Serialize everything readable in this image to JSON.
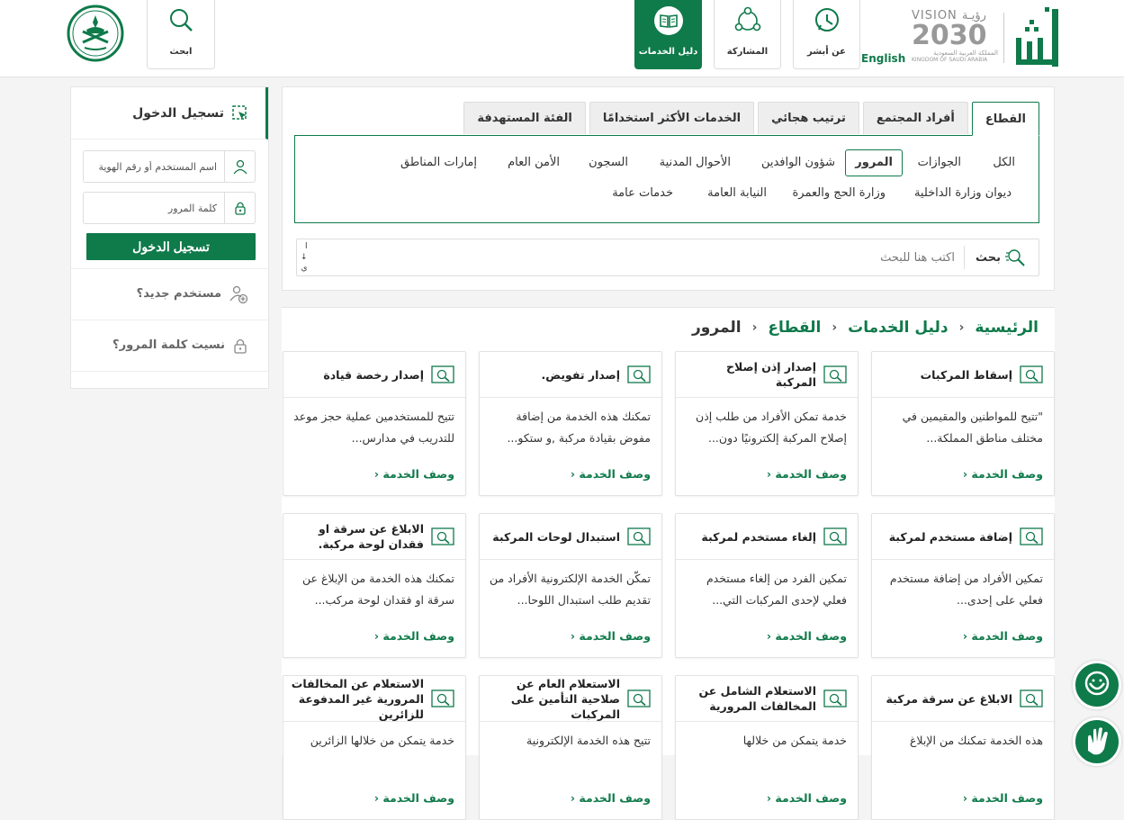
{
  "header": {
    "logo_text": "أبشر",
    "vision": {
      "line1": "VISION",
      "line1_ar": "رؤيـة",
      "year": "2030",
      "ar_country": "المملكة العربية السعودية",
      "en_country": "KINGDOM OF SAUDI ARABIA"
    },
    "nav": [
      {
        "label": "عن أبشر",
        "icon": "chat-bubble-icon"
      },
      {
        "label": "المشاركة",
        "icon": "community-icon"
      },
      {
        "label": "دليل الخدمات",
        "icon": "book-icon",
        "active": true
      }
    ],
    "lang": "English",
    "search_label": "ابحث"
  },
  "login": {
    "title": "تسجيل الدخول",
    "username_placeholder": "اسم المستخدم أو رقم الهوية",
    "password_placeholder": "كلمة المرور",
    "submit": "تسجيل الدخول",
    "new_user": "مستخدم جديد؟",
    "forgot": "نسيت كلمة المرور؟"
  },
  "filter": {
    "tabs": [
      "القطاع",
      "أفراد المجتمع",
      "ترتيب هجائي",
      "الخدمات الأكثر استخدامًا",
      "الفئة المستهدفة"
    ],
    "chips_row1": [
      "الكل",
      "الجوازات",
      "المرور",
      "شؤون الوافدين",
      "الأحوال المدنية",
      "السجون",
      "الأمن العام",
      "إمارات المناطق"
    ],
    "chips_row2": [
      "ديوان وزارة الداخلية",
      "وزارة الحج والعمرة",
      "النيابة العامة",
      "خدمات عامة"
    ],
    "search_button": "بحث",
    "search_placeholder": "اكتب هنا للبحث",
    "scroll_glyphs": [
      "ا",
      "↓",
      "ي"
    ]
  },
  "breadcrumb": [
    "الرئيسية",
    "دليل الخدمات",
    "القطاع",
    "المرور"
  ],
  "cards": [
    {
      "title": "إسقاط المركبات",
      "desc": "\"تتيح للمواطنين والمقيمين في مختلف مناطق المملكة...",
      "more": "وصف الخدمة"
    },
    {
      "title": "إصدار إذن إصلاح المركبة",
      "desc": "خدمة تمكن الأفراد من طلب إذن إصلاح المركبة إلكترونيًا دون...",
      "more": "وصف الخدمة"
    },
    {
      "title": "إصدار تفويض.",
      "desc": "تمكنك هذه الخدمة من إضافة مفوض بقيادة مركبة ,و ستكو...",
      "more": "وصف الخدمة"
    },
    {
      "title": "إصدار رخصة قيادة",
      "desc": "تتيح للمستخدمين عملية حجز موعد للتدريب في مدارس...",
      "more": "وصف الخدمة"
    },
    {
      "title": "إضافة مستخدم لمركبة",
      "desc": "تمكين الأفراد من إضافة مستخدم فعلي على إحدى...",
      "more": "وصف الخدمة"
    },
    {
      "title": "إلغاء مستخدم لمركبة",
      "desc": "تمكين الفرد من إلغاء مستخدم فعلي لإحدى المركبات التي...",
      "more": "وصف الخدمة"
    },
    {
      "title": "استبدال لوحات المركبة",
      "desc": "تمكّن الخدمة الإلكترونية الأفراد من تقديم طلب استبدال اللوحا...",
      "more": "وصف الخدمة"
    },
    {
      "title": "الابلاغ عن سرقة او فقدان لوحة مركبة.",
      "desc": "تمكنك هذه الخدمة من الإبلاغ عن سرقة او فقدان لوحة مركب...",
      "more": "وصف الخدمة"
    },
    {
      "title": "الابلاغ عن سرقة مركبة",
      "desc": "هذه الخدمة تمكنك من الإبلاغ",
      "more": "وصف الخدمة"
    },
    {
      "title": "الاستعلام الشامل عن المخالفات المرورية",
      "desc": "خدمة يتمكن من خلالها",
      "more": "وصف الخدمة"
    },
    {
      "title": "الاستعلام العام عن صلاحية التأمين على المركبات",
      "desc": "تتيح هذه الخدمة الإلكترونية",
      "more": "وصف الخدمة"
    },
    {
      "title": "الاستعلام عن المخالفات المرورية غير المدفوعة للزائرين",
      "desc": "خدمة يتمكن من خلالها الزائرين",
      "more": "وصف الخدمة"
    }
  ],
  "colors": {
    "brand": "#0f7a4a"
  }
}
